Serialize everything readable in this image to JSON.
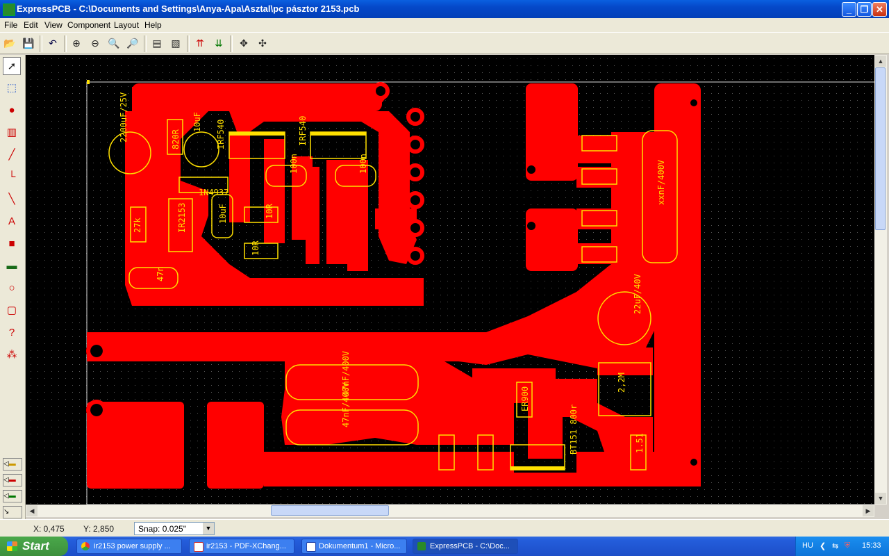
{
  "window": {
    "title": "ExpressPCB - C:\\Documents and Settings\\Anya-Apa\\Asztal\\pc pásztor 2153.pcb",
    "minimize": "_",
    "maximize": "❐",
    "close": "✕"
  },
  "menu": [
    "File",
    "Edit",
    "View",
    "Component",
    "Layout",
    "Help"
  ],
  "toolbar": {
    "icons": [
      "open-icon",
      "save-icon",
      "undo-icon",
      "zoom-in-icon",
      "zoom-out-icon",
      "zoom-board-icon",
      "zoom-window-icon",
      "properties-icon",
      "board-props-icon",
      "top-layer-icon",
      "bottom-layer-icon",
      "move-icon",
      "align-icon"
    ]
  },
  "left_tools": {
    "icons": [
      "pointer-icon",
      "zoom-area-icon",
      "pad-icon",
      "component-icon",
      "trace-icon",
      "corner-icon",
      "ratsnest-icon",
      "text-icon",
      "layer-icon",
      "plane-icon",
      "circle-icon",
      "rectangle-icon",
      "query-icon",
      "netlist-icon"
    ]
  },
  "pcb": {
    "labels": {
      "c1": "2200uF/25V",
      "c2": "10uF",
      "r1": "820R",
      "t1": "IRF540",
      "t2": "IRF540",
      "c3": "100n",
      "c4": "100n",
      "d1": "1N4937",
      "ic": "IR2153",
      "r2": "27k",
      "c5": "10uF",
      "r3": "10R",
      "r4": "10R",
      "c6": "47n",
      "c7": "xxnF/400V",
      "c8": "22uF/40V",
      "c9": "47nF/400V",
      "c10": "47nF/400V",
      "r5": "ER900",
      "t3": "BT151 800r",
      "r6": "2,2M",
      "r7": "1.51"
    },
    "trace_color": "#ff0000",
    "silk_color": "#ffe000"
  },
  "status": {
    "x": "X: 0,475",
    "y": "Y: 2,850",
    "snap": "Snap: 0.025\""
  },
  "taskbar": {
    "start": "Start",
    "tasks": [
      {
        "label": "ir2153 power supply ...",
        "icon": "chrome-icon"
      },
      {
        "label": "ir2153 - PDF-XChang...",
        "icon": "pdf-icon"
      },
      {
        "label": "Dokumentum1 - Micro...",
        "icon": "word-icon"
      },
      {
        "label": "ExpressPCB - C:\\Doc...",
        "icon": "expresspcb-icon"
      }
    ],
    "lang": "HU",
    "time": "15:33"
  }
}
